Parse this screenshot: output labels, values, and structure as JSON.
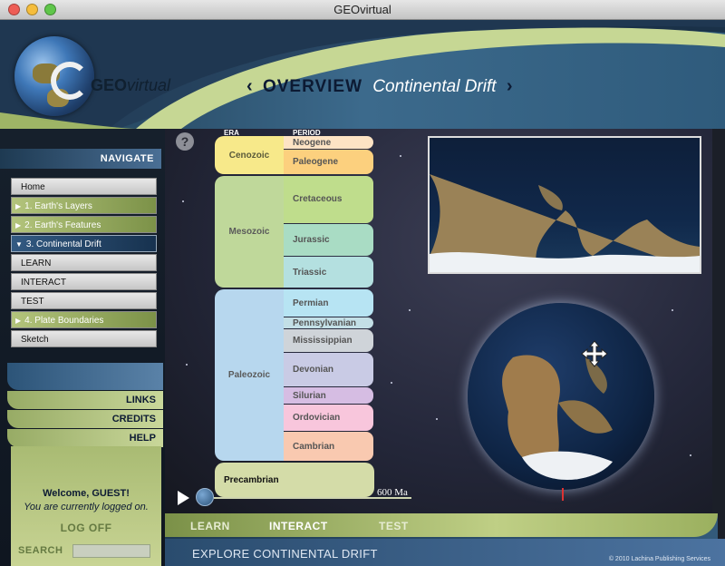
{
  "window": {
    "title": "GEOvirtual"
  },
  "header": {
    "logo_geo": "GEO",
    "logo_virtual": "virtual",
    "arrow_left": "‹",
    "arrow_right": "›",
    "section": "OVERVIEW",
    "topic": "Continental Drift"
  },
  "nav": {
    "navigate_label": "NAVIGATE",
    "items": [
      {
        "label": "Home",
        "style": "gray"
      },
      {
        "label": "1. Earth's Layers",
        "style": "green",
        "icon": "play-triangle-icon"
      },
      {
        "label": "2. Earth's Features",
        "style": "green",
        "icon": "play-triangle-icon"
      },
      {
        "label": "3. Continental Drift",
        "style": "blue",
        "icon": "expand-triangle-icon"
      },
      {
        "label": "LEARN",
        "style": "gray"
      },
      {
        "label": "INTERACT",
        "style": "gray"
      },
      {
        "label": "TEST",
        "style": "gray"
      },
      {
        "label": "4. Plate Boundaries",
        "style": "green",
        "icon": "play-triangle-icon"
      },
      {
        "label": "Sketch",
        "style": "gray"
      }
    ],
    "links": "LINKS",
    "credits": "CREDITS",
    "help": "HELP",
    "welcome": "Welcome, GUEST!",
    "logged_on": "You are currently logged on.",
    "log_off": "LOG OFF",
    "search_label": "SEARCH",
    "search_value": ""
  },
  "timescale": {
    "era_header": "ERA",
    "period_header": "PERIOD",
    "eras": [
      {
        "name": "Cenozoic",
        "color": "#f7e98a"
      },
      {
        "name": "Mesozoic",
        "color": "#bfd89a"
      },
      {
        "name": "Paleozoic",
        "color": "#b7d7ee"
      },
      {
        "name": "Precambrian",
        "color": "#d4dca8"
      }
    ],
    "periods": [
      {
        "name": "Neogene",
        "color": "#fde3c4"
      },
      {
        "name": "Paleogene",
        "color": "#fcd07e"
      },
      {
        "name": "Cretaceous",
        "color": "#bfdd8c"
      },
      {
        "name": "Jurassic",
        "color": "#a9dcc4"
      },
      {
        "name": "Triassic",
        "color": "#b4e0e0"
      },
      {
        "name": "Permian",
        "color": "#b7e4f3"
      },
      {
        "name": "Pennsylvanian",
        "color": "#c3dfe6"
      },
      {
        "name": "Mississippian",
        "color": "#cfd4d9"
      },
      {
        "name": "Devonian",
        "color": "#c9cbe5"
      },
      {
        "name": "Silurian",
        "color": "#d6bde3"
      },
      {
        "name": "Ordovician",
        "color": "#f8c6dc"
      },
      {
        "name": "Cambrian",
        "color": "#f9c9b0"
      }
    ],
    "time_label": "600 Ma",
    "slider_fraction": 0.0
  },
  "modes": {
    "learn": "LEARN",
    "interact": "INTERACT",
    "test": "TEST",
    "active": "INTERACT"
  },
  "footer": {
    "explore": "EXPLORE CONTINENTAL DRIFT",
    "copyright": "© 2010 Lachina Publishing Services"
  },
  "icons": {
    "help": "help-circle-icon",
    "move": "move-arrows-icon",
    "play": "play-icon"
  }
}
